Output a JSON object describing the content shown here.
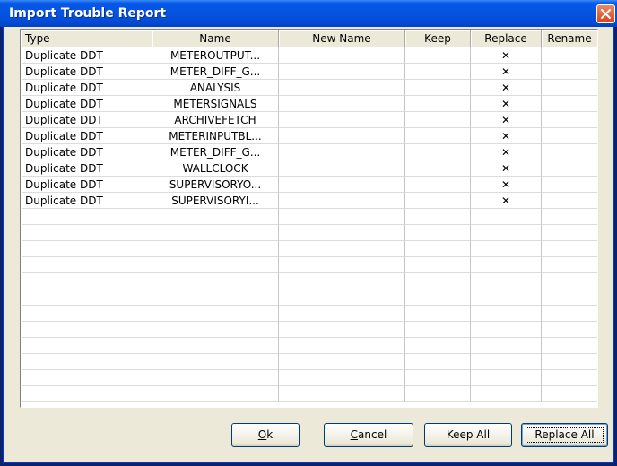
{
  "window": {
    "title": "Import Trouble Report"
  },
  "table": {
    "columns": [
      "Type",
      "Name",
      "New Name",
      "Keep",
      "Replace",
      "Rename"
    ],
    "rows": [
      {
        "type": "Duplicate DDT",
        "name": "METEROUTPUT...",
        "new_name": "",
        "keep": "",
        "replace": "✕",
        "rename": ""
      },
      {
        "type": "Duplicate DDT",
        "name": "METER_DIFF_G...",
        "new_name": "",
        "keep": "",
        "replace": "✕",
        "rename": ""
      },
      {
        "type": "Duplicate DDT",
        "name": "ANALYSIS",
        "new_name": "",
        "keep": "",
        "replace": "✕",
        "rename": ""
      },
      {
        "type": "Duplicate DDT",
        "name": "METERSIGNALS",
        "new_name": "",
        "keep": "",
        "replace": "✕",
        "rename": ""
      },
      {
        "type": "Duplicate DDT",
        "name": "ARCHIVEFETCH",
        "new_name": "",
        "keep": "",
        "replace": "✕",
        "rename": ""
      },
      {
        "type": "Duplicate DDT",
        "name": "METERINPUTBL...",
        "new_name": "",
        "keep": "",
        "replace": "✕",
        "rename": ""
      },
      {
        "type": "Duplicate DDT",
        "name": "METER_DIFF_G...",
        "new_name": "",
        "keep": "",
        "replace": "✕",
        "rename": ""
      },
      {
        "type": "Duplicate DDT",
        "name": "WALLCLOCK",
        "new_name": "",
        "keep": "",
        "replace": "✕",
        "rename": ""
      },
      {
        "type": "Duplicate DDT",
        "name": "SUPERVISORYO...",
        "new_name": "",
        "keep": "",
        "replace": "✕",
        "rename": ""
      },
      {
        "type": "Duplicate DDT",
        "name": "SUPERVISORYI...",
        "new_name": "",
        "keep": "",
        "replace": "✕",
        "rename": ""
      }
    ]
  },
  "buttons": {
    "ok": {
      "accel": "O",
      "rest": "k"
    },
    "cancel": {
      "accel": "C",
      "rest": "ancel"
    },
    "keep_all": "Keep All",
    "replace_all": "Replace All"
  },
  "colors": {
    "titlebar": "#0454e0",
    "client": "#ece9d8",
    "close": "#d9431c"
  },
  "icons": {
    "close": "close-icon"
  }
}
